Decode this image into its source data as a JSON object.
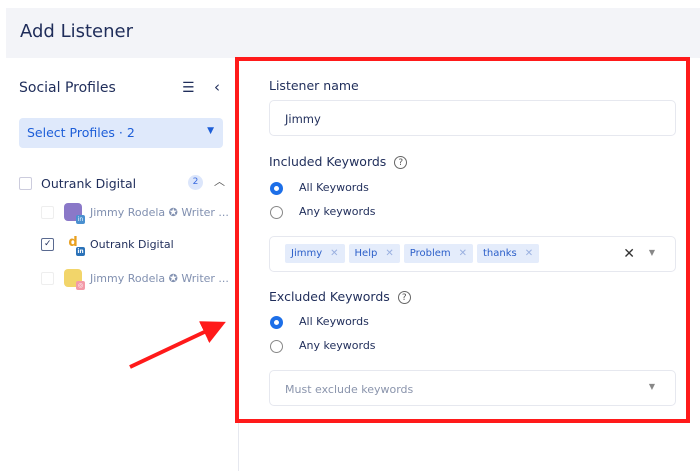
{
  "header": {
    "title": "Add Listener"
  },
  "sidebar": {
    "title": "Social Profiles",
    "select_label": "Select Profiles · 2",
    "group": {
      "name": "Outrank Digital",
      "count": "2"
    },
    "items": [
      {
        "label": "Jimmy Rodela ✪ Writer ...",
        "network": "linkedin",
        "checked": false
      },
      {
        "label": "Outrank Digital",
        "network": "linkedin",
        "checked": true
      },
      {
        "label": "Jimmy Rodela ✪ Writer ...",
        "network": "instagram",
        "checked": false
      }
    ]
  },
  "form": {
    "listener_name_label": "Listener name",
    "listener_name_value": "Jimmy",
    "included_label": "Included Keywords",
    "included_options": [
      "All Keywords",
      "Any keywords"
    ],
    "included_selected": "All Keywords",
    "keywords": [
      "Jimmy",
      "Help",
      "Problem",
      "thanks"
    ],
    "excluded_label": "Excluded Keywords",
    "excluded_options": [
      "All Keywords",
      "Any keywords"
    ],
    "excluded_selected": "All Keywords",
    "excluded_placeholder": "Must exclude keywords"
  },
  "colors": {
    "accent": "#1d6fe8",
    "highlight": "#ff1a1a"
  }
}
